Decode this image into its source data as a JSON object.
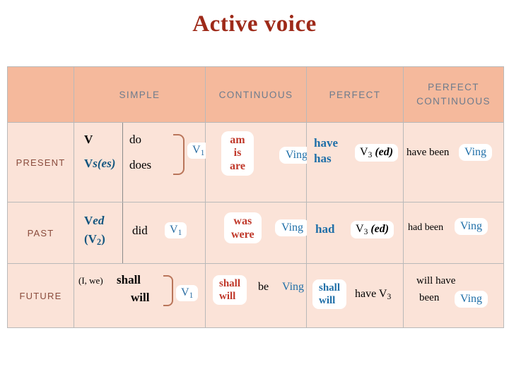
{
  "title": "Active voice",
  "table": {
    "corner": "",
    "columns": [
      "SIMPLE",
      "CONTINUOUS",
      "PERFECT",
      "PERFECT CONTINUOUS"
    ],
    "column_perfect_continuous_line1": "PERFECT",
    "column_perfect_continuous_line2": "CONTINUOUS",
    "rows": [
      {
        "label": "PRESENT",
        "simple": {
          "form1": "V",
          "form2_stem": "V",
          "form2_ending": "s(es)",
          "aux1": "do",
          "aux2": "does",
          "verb_box": "V",
          "verb_box_sub": "1"
        },
        "continuous": {
          "aux_line1": "am",
          "aux_line2": "is",
          "aux_line3": "are",
          "verb": "Ving"
        },
        "perfect": {
          "aux_line1": "have",
          "aux_line2": "has",
          "verb": "V",
          "verb_sub": "3",
          "verb_alt": "(ed)"
        },
        "perfect_continuous": {
          "aux": "have been",
          "verb": "Ving"
        }
      },
      {
        "label": "PAST",
        "simple": {
          "form1_stem": "V",
          "form1_ending": "ed",
          "form2": "(V",
          "form2_sub": "2",
          "form2_close": ")",
          "aux": "did",
          "verb_box": "V",
          "verb_box_sub": "1"
        },
        "continuous": {
          "aux_line1": "was",
          "aux_line2": "were",
          "verb": "Ving"
        },
        "perfect": {
          "aux": "had",
          "verb": "V",
          "verb_sub": "3",
          "verb_alt": "(ed)"
        },
        "perfect_continuous": {
          "aux": "had been",
          "verb": "Ving"
        }
      },
      {
        "label": "FUTURE",
        "simple": {
          "subject_note": "(I, we)",
          "aux1": "shall",
          "aux2": "will",
          "verb_box": "V",
          "verb_box_sub": "1"
        },
        "continuous": {
          "aux_line1": "shall",
          "aux_line2": "will",
          "be": "be",
          "verb": "Ving"
        },
        "perfect": {
          "aux_line1": "shall",
          "aux_line2": "will",
          "have": "have V",
          "have_sub": "3"
        },
        "perfect_continuous": {
          "line1": "will have",
          "line2": "been",
          "verb": "Ving"
        }
      }
    ]
  },
  "colors": {
    "title": "#9e2a19",
    "header_bg": "#f5b99c",
    "body_bg": "#fbe3d8",
    "header_text": "#6d7b8d",
    "row_label": "#8a4b3c",
    "blue": "#1f6fa8",
    "red_aux": "#c0392b"
  }
}
